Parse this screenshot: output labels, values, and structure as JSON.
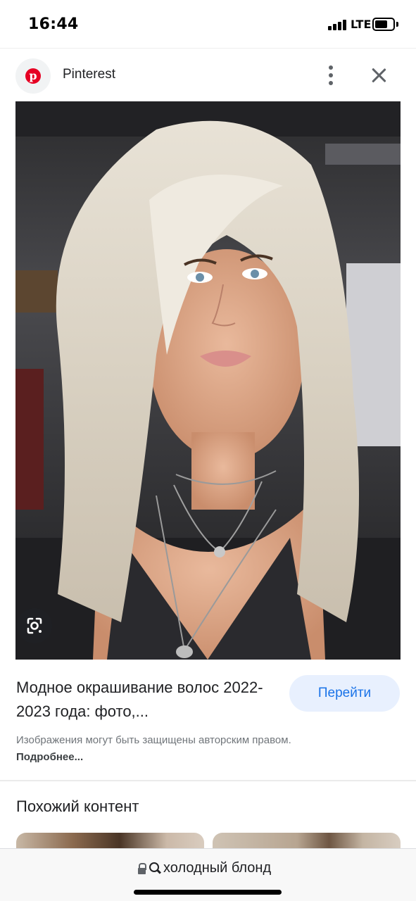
{
  "status_bar": {
    "time": "16:44",
    "network": "LTE",
    "icons": [
      "signal-icon",
      "battery-icon"
    ]
  },
  "topbar": {
    "site_name": "Pinterest",
    "icons": [
      "pinterest-logo-icon",
      "more-vert-icon",
      "close-icon"
    ]
  },
  "hero": {
    "icons": [
      "google-lens-icon"
    ]
  },
  "result": {
    "title": "Модное окрашивание волос 2022-2023 года: фото,...",
    "visit_label": "Перейти",
    "copyright_text": "Изображения могут быть защищены авторским правом.",
    "learn_more": "Подробнее..."
  },
  "related": {
    "heading": "Похожий контент"
  },
  "address_bar": {
    "query": "холодный блонд",
    "icons": [
      "lock-icon",
      "search-icon"
    ]
  },
  "colors": {
    "accent": "#1a73e8",
    "button_bg": "#e8f0fe",
    "pinterest_red": "#e60023"
  }
}
